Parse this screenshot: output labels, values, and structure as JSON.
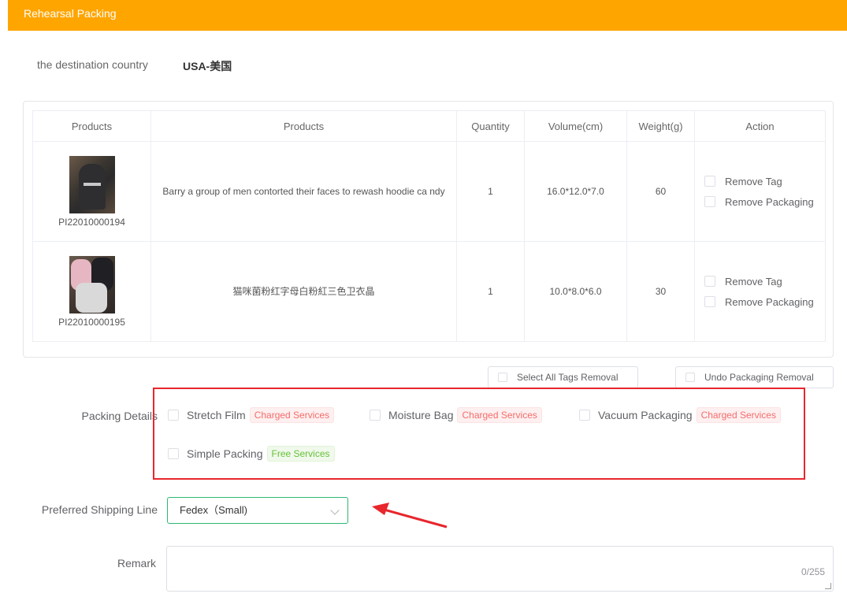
{
  "header": {
    "title": "Rehearsal Packing"
  },
  "destination": {
    "label": "the destination country",
    "value": "USA-美国"
  },
  "table": {
    "columns": [
      "Products",
      "Products",
      "Quantity",
      "Volume(cm)",
      "Weight(g)",
      "Action"
    ],
    "rows": [
      {
        "sku": "PI22010000194",
        "name": "Barry a group of men contorted their faces to rewash hoodie ca ndy",
        "quantity": "1",
        "volume": "16.0*12.0*7.0",
        "weight": "60",
        "remove_tag": "Remove Tag",
        "remove_packaging": "Remove Packaging"
      },
      {
        "sku": "PI22010000195",
        "name": "猫咪菌粉红字母白粉紅三色卫衣晶",
        "quantity": "1",
        "volume": "10.0*8.0*6.0",
        "weight": "30",
        "remove_tag": "Remove Tag",
        "remove_packaging": "Remove Packaging"
      }
    ]
  },
  "bulk": {
    "select_all_tags": "Select All Tags Removal",
    "undo_packaging": "Undo Packaging Removal"
  },
  "packing": {
    "label": "Packing Details",
    "options": [
      {
        "name": "Stretch Film",
        "tag": "Charged Services"
      },
      {
        "name": "Moisture Bag",
        "tag": "Charged Services"
      },
      {
        "name": "Vacuum Packaging",
        "tag": "Charged Services"
      },
      {
        "name": "Simple Packing",
        "tag": "Free Services"
      }
    ]
  },
  "shipping": {
    "label": "Preferred Shipping Line",
    "value": "Fedex（Small)"
  },
  "remark": {
    "label": "Remark",
    "count": "0/255"
  },
  "colors": {
    "header": "#ffa500",
    "highlight": "#e8262c",
    "select_border": "#2eb872"
  }
}
